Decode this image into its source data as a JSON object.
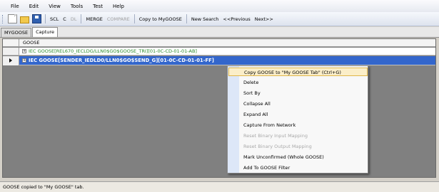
{
  "menu": [
    "File",
    "Edit",
    "View",
    "Tools",
    "Test",
    "Help"
  ],
  "toolbar": {
    "icons": [
      "new-file-icon",
      "open-folder-icon",
      "save-disk-icon"
    ],
    "buttons": [
      {
        "label": "SCL",
        "enabled": true
      },
      {
        "label": "C",
        "enabled": true
      },
      {
        "label": "DL",
        "enabled": false
      },
      {
        "label": "MERGE",
        "enabled": true
      },
      {
        "label": "COMPARE",
        "enabled": false
      },
      {
        "label": "Copy to MyGOOSE",
        "enabled": true
      },
      {
        "label": "New Search",
        "enabled": true
      },
      {
        "label": "<<Previous",
        "enabled": true
      },
      {
        "label": "Next>>",
        "enabled": true
      }
    ]
  },
  "tabs": [
    {
      "label": "MYGOOSE",
      "active": false
    },
    {
      "label": "Capture",
      "active": true
    }
  ],
  "grid": {
    "column_header": "GOOSE",
    "rows": [
      {
        "text": "IEC GOOSE[REL670_IECLDG/LLN0$GO$GOOSE_TRI][01-0C-CD-01-01-AB]",
        "selected": false
      },
      {
        "text": "IEC GOOSE[SENDER_IEDLD0/LLN0$GO$SEND_G][01-0C-CD-01-01-FF]",
        "selected": true
      }
    ]
  },
  "context_menu": {
    "items": [
      {
        "label": "Copy GOOSE to \"My GOOSE Tab\" (Ctrl+G)",
        "enabled": true,
        "highlighted": true
      },
      {
        "label": "Delete",
        "enabled": true
      },
      {
        "label": "Sort By",
        "enabled": true
      },
      {
        "label": "Collapse All",
        "enabled": true
      },
      {
        "label": "Expand All",
        "enabled": true
      },
      {
        "label": "Capture From Network",
        "enabled": true
      },
      {
        "label": "Reset Binary Input Mapping",
        "enabled": false
      },
      {
        "label": "Reset Binary Output Mapping",
        "enabled": false
      },
      {
        "label": "Mark Unconfirmed (Whole GOOSE)",
        "enabled": true
      },
      {
        "label": "Add To GOOSE Filter",
        "enabled": true
      }
    ]
  },
  "status": "GOOSE copied to \"My GOOSE\" tab.",
  "colors": {
    "selection": "#3366cc",
    "menu_highlight": "#fbeec8",
    "row_text_green": "#2a8a2a"
  }
}
